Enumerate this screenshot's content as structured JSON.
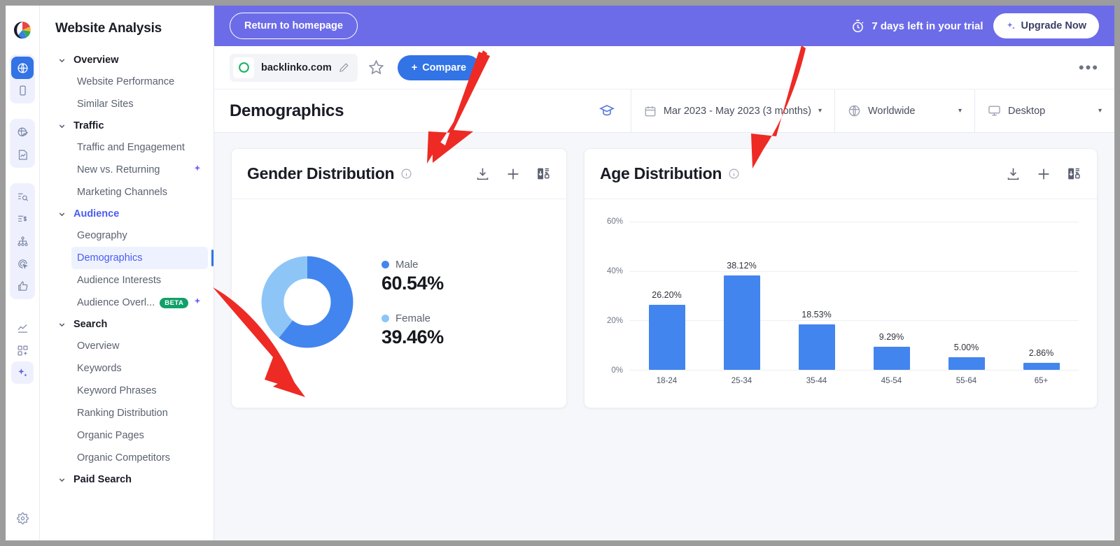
{
  "rail": {
    "logo": "similarweb-logo",
    "icons": [
      {
        "name": "globe-icon",
        "active": true
      },
      {
        "name": "mobile-icon",
        "active": false
      },
      {
        "name": "globe-analytics-icon",
        "active": false
      },
      {
        "name": "report-chart-icon",
        "active": false
      },
      {
        "name": "keyword-search-icon",
        "active": false
      },
      {
        "name": "keyword-list-icon",
        "active": false
      },
      {
        "name": "network-icon",
        "active": false
      },
      {
        "name": "target-click-icon",
        "active": false
      },
      {
        "name": "thumbs-up-icon",
        "active": false
      },
      {
        "name": "trend-line-icon",
        "active": false
      },
      {
        "name": "add-widget-icon",
        "active": false
      },
      {
        "name": "ai-sparkle-icon",
        "active": false
      }
    ],
    "settings": "gear-icon"
  },
  "sidebar": {
    "title": "Website Analysis",
    "groups": [
      {
        "label": "Overview",
        "selected": false,
        "items": [
          {
            "label": "Website Performance"
          },
          {
            "label": "Similar Sites"
          }
        ]
      },
      {
        "label": "Traffic",
        "selected": false,
        "items": [
          {
            "label": "Traffic and Engagement"
          },
          {
            "label": "New vs. Returning",
            "sparkle": true
          },
          {
            "label": "Marketing Channels"
          }
        ]
      },
      {
        "label": "Audience",
        "selected": true,
        "items": [
          {
            "label": "Geography"
          },
          {
            "label": "Demographics",
            "active": true
          },
          {
            "label": "Audience Interests"
          },
          {
            "label": "Audience Overl...",
            "badge": "BETA",
            "sparkle": true
          }
        ]
      },
      {
        "label": "Search",
        "selected": false,
        "items": [
          {
            "label": "Overview"
          },
          {
            "label": "Keywords"
          },
          {
            "label": "Keyword Phrases"
          },
          {
            "label": "Ranking Distribution"
          },
          {
            "label": "Organic Pages"
          },
          {
            "label": "Organic Competitors"
          }
        ]
      },
      {
        "label": "Paid Search",
        "selected": false,
        "items": []
      }
    ]
  },
  "trial_bar": {
    "return_label": "Return to homepage",
    "trial_text": "7 days left in your trial",
    "upgrade_label": "Upgrade Now",
    "clock_icon": "stopwatch-icon",
    "sparkle_icon": "sparkle-icon",
    "bg_color": "#6c6ce8"
  },
  "site_bar": {
    "domain": "backlinko.com",
    "edit_icon": "pencil-icon",
    "star_icon": "star-outline-icon",
    "compare_label": "Compare",
    "compare_plus": "+",
    "more_icon": "more-horizontal-icon",
    "favicon": "green-circle-favicon"
  },
  "page_bar": {
    "title": "Demographics",
    "academy_icon": "graduation-cap-icon",
    "filters": [
      {
        "icon": "calendar-icon",
        "label": "Mar 2023 - May 2023 (3 months)",
        "caret": true
      },
      {
        "icon": "globe-icon",
        "label": "Worldwide",
        "caret": true
      },
      {
        "icon": "desktop-icon",
        "label": "Desktop",
        "caret": true
      }
    ]
  },
  "cards": {
    "gender": {
      "title": "Gender Distribution",
      "info_icon": "info-circle-icon",
      "tools": [
        "download-icon",
        "plus-icon",
        "export-locked-icon"
      ]
    },
    "age": {
      "title": "Age Distribution",
      "info_icon": "info-circle-icon",
      "tools": [
        "download-icon",
        "plus-icon",
        "export-locked-icon"
      ]
    }
  },
  "chart_data": [
    {
      "type": "pie",
      "title": "Gender Distribution",
      "labels": [
        "Male",
        "Female"
      ],
      "values": [
        60.54,
        39.46
      ],
      "value_labels": [
        "60.54%",
        "39.46%"
      ],
      "colors": [
        "#4285ef",
        "#8ec5f7"
      ],
      "donut": true,
      "legend_position": "right"
    },
    {
      "type": "bar",
      "title": "Age Distribution",
      "categories": [
        "18-24",
        "25-34",
        "35-44",
        "45-54",
        "55-64",
        "65+"
      ],
      "values": [
        26.2,
        38.12,
        18.53,
        9.29,
        5.0,
        2.86
      ],
      "data_labels": [
        "26.20%",
        "38.12%",
        "18.53%",
        "9.29%",
        "5.00%",
        "2.86%"
      ],
      "ylabel": "",
      "xlabel": "",
      "ylim": [
        0,
        60
      ],
      "yticks": [
        0,
        20,
        40,
        60
      ],
      "ytick_labels": [
        "0%",
        "20%",
        "40%",
        "60%"
      ],
      "grid": true,
      "bar_color": "#4285ef"
    }
  ],
  "annotations": [
    {
      "name": "arrow-to-gender-card",
      "color": "#ee2a24"
    },
    {
      "name": "arrow-to-age-card",
      "color": "#ee2a24"
    },
    {
      "name": "arrow-to-demographics-nav",
      "color": "#ee2a24"
    }
  ]
}
